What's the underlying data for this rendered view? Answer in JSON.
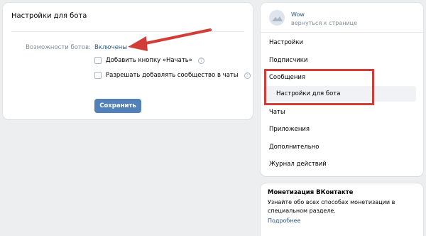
{
  "main": {
    "title": "Настройки для бота",
    "bots_label": "Возможности ботов:",
    "bots_value": "Включены",
    "start_button_option": "Добавить кнопку «Начать»",
    "allow_chats_option": "Разрешать добавлять сообщество в чаты",
    "help_glyph": "?",
    "save_label": "Сохранить"
  },
  "group": {
    "name": "Wow",
    "back_label": "вернуться к странице"
  },
  "nav": {
    "items": [
      {
        "label": "Настройки"
      },
      {
        "label": "Подписчики"
      },
      {
        "label": "Сообщения"
      },
      {
        "label": "Настройки для бота"
      },
      {
        "label": "Чаты"
      },
      {
        "label": "Приложения"
      },
      {
        "label": "Дополнительно"
      },
      {
        "label": "Журнал действий"
      }
    ]
  },
  "monetization": {
    "title": "Монетизация ВКонтакте",
    "text": "Узнайте обо всех способах монетизации в специальном разделе.",
    "link": "Подробнее"
  },
  "colors": {
    "accent": "#5181b8",
    "link": "#2a5885",
    "annotation": "#d13e3a"
  }
}
